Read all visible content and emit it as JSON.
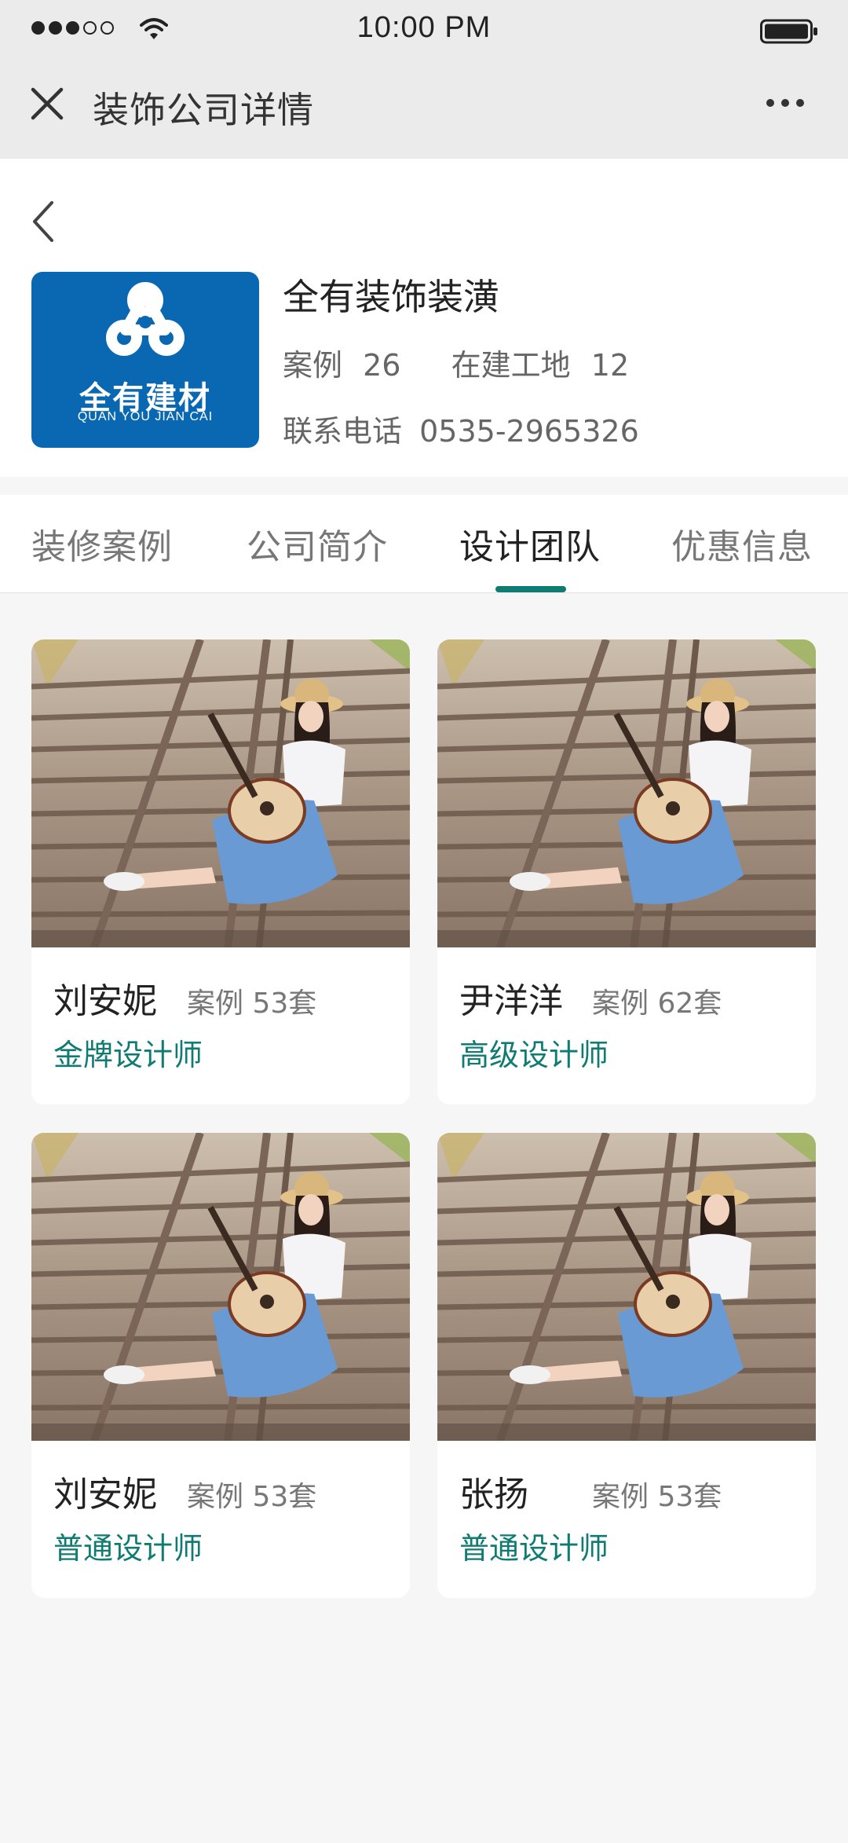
{
  "status_bar": {
    "time": "10:00 PM"
  },
  "nav": {
    "title": "装饰公司详情"
  },
  "company": {
    "logo_text": "全有建材",
    "logo_subtext": "QUAN YOU JIAN CAI",
    "name": "全有装饰装潢",
    "cases_label": "案例",
    "cases_count": "26",
    "sites_label": "在建工地",
    "sites_count": "12",
    "phone_label": "联系电话",
    "phone": "0535-2965326"
  },
  "tabs": [
    {
      "label": "装修案例",
      "active": false
    },
    {
      "label": "公司简介",
      "active": false
    },
    {
      "label": "设计团队",
      "active": true
    },
    {
      "label": "优惠信息",
      "active": false
    }
  ],
  "designers": [
    {
      "name": "刘安妮",
      "cases": "案例  53套",
      "level": "金牌设计师"
    },
    {
      "name": "尹洋洋",
      "cases": "案例  62套",
      "level": "高级设计师"
    },
    {
      "name": "刘安妮",
      "cases": "案例  53套",
      "level": "普通设计师"
    },
    {
      "name": "张扬",
      "cases": "案例  53套",
      "level": "普通设计师"
    }
  ],
  "colors": {
    "accent": "#0f7b72",
    "logo_bg": "#0a67b1",
    "header_bg": "#ebebeb"
  }
}
